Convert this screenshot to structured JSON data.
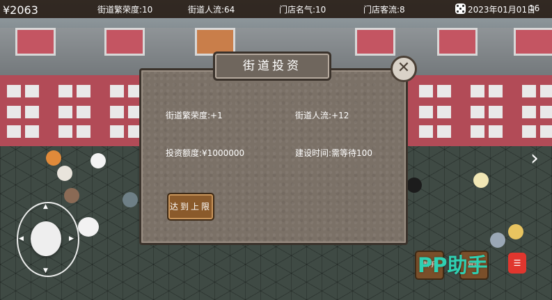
{
  "hud": {
    "money": "¥2063",
    "street_prosperity": "街道繁荣度:10",
    "street_traffic": "街道人流:64",
    "store_fame": "门店名气:10",
    "store_customers": "门店客流:8",
    "date": "2023年01月01日",
    "time": "16"
  },
  "dialog": {
    "title": "街道投资",
    "prosperity_gain": "街道繁荣度:+1",
    "traffic_gain": "街道人流:+12",
    "investment_amount": "投资额度:¥1000000",
    "build_time": "建设时间:需等待100",
    "max_button": "达到上限"
  },
  "controls": {
    "newbie_button": "新手",
    "right_button": "冒险"
  },
  "watermark": {
    "text": "PP助手",
    "color": "#2fd0b2"
  },
  "icons": [
    "dice-icon",
    "close-icon",
    "next-arrow-icon",
    "joystick-arrow-icon"
  ]
}
